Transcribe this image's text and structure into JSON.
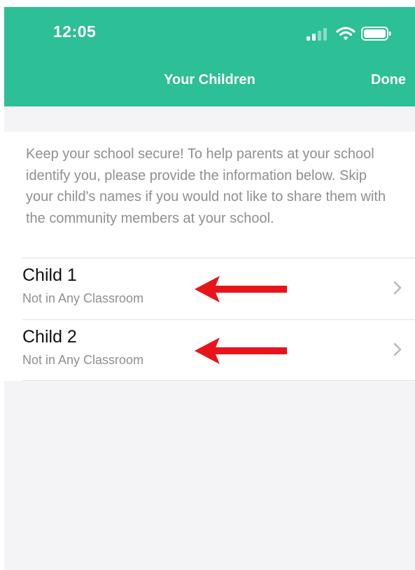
{
  "status_bar": {
    "time": "12:05",
    "icons": [
      "signal-icon",
      "wifi-icon",
      "battery-icon"
    ]
  },
  "nav": {
    "title": "Your Children",
    "done_label": "Done"
  },
  "info": {
    "text": "Keep your school secure!  To help parents at your school identify you, please provide the information below. Skip your child's names if you would not like to share them with the community members at your school."
  },
  "children": [
    {
      "name": "Child 1",
      "classroom": "Not in Any Classroom"
    },
    {
      "name": "Child 2",
      "classroom": "Not in Any Classroom"
    }
  ],
  "colors": {
    "accent": "#2dbf95",
    "annotation_arrow": "#e8141c"
  }
}
